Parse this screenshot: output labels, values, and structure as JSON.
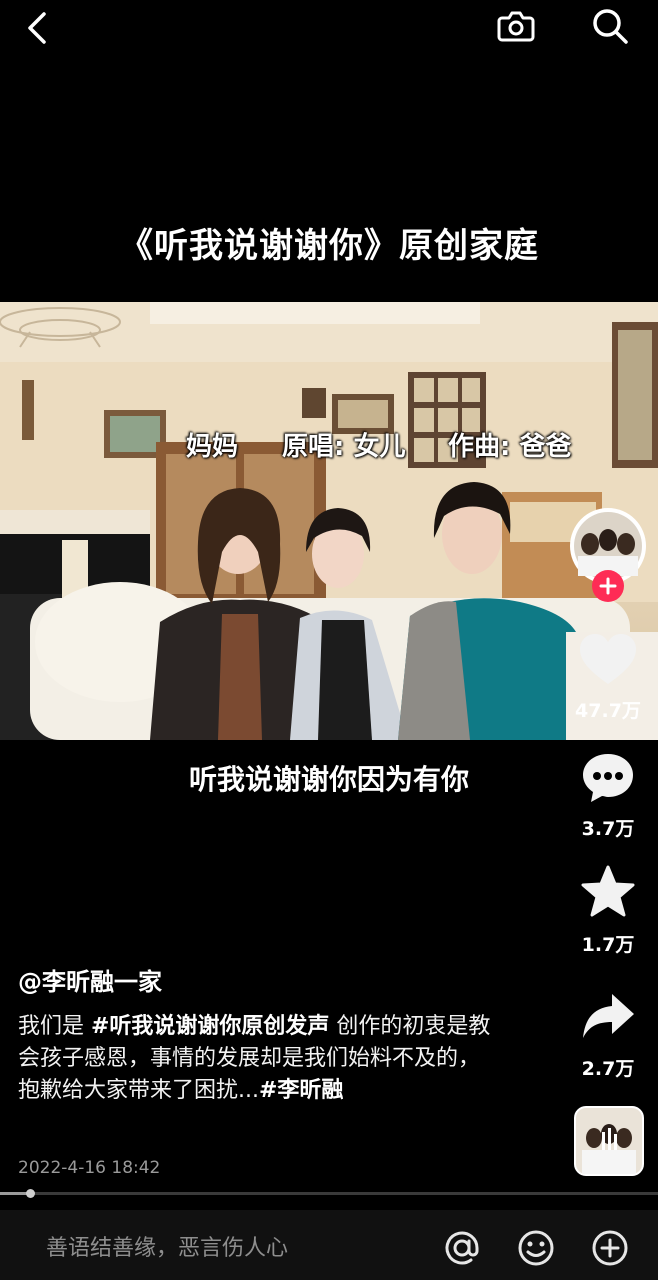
{
  "top_bar": {
    "back_icon": "chevron-left-icon",
    "camera_icon": "camera-icon",
    "search_icon": "search-icon"
  },
  "video": {
    "overlay_title": "《听我说谢谢你》原创家庭",
    "credit_mom": "妈妈",
    "credit_singer": "原唱: 女儿",
    "credit_composer": "作曲: 爸爸",
    "lyric": "听我说谢谢你因为有你"
  },
  "rail": {
    "like_count": "47.7万",
    "comment_count": "3.7万",
    "favorite_count": "1.7万",
    "share_count": "2.7万"
  },
  "post": {
    "author": "@李昕融一家",
    "desc_prefix": "我们是 ",
    "desc_tag1": "#听我说谢谢你原创发声",
    "desc_body": " 创作的初衷是教会孩子感恩，事情的发展却是我们始料不及的，抱歉给大家带来了困扰...",
    "desc_tag2": "#李昕融",
    "date": "2022-4-16 18:42"
  },
  "progress": {
    "fraction": 0.045
  },
  "comment_bar": {
    "placeholder": "善语结善缘，恶言伤人心"
  },
  "colors": {
    "follow_badge": "#fe2c55",
    "background": "#000000"
  }
}
